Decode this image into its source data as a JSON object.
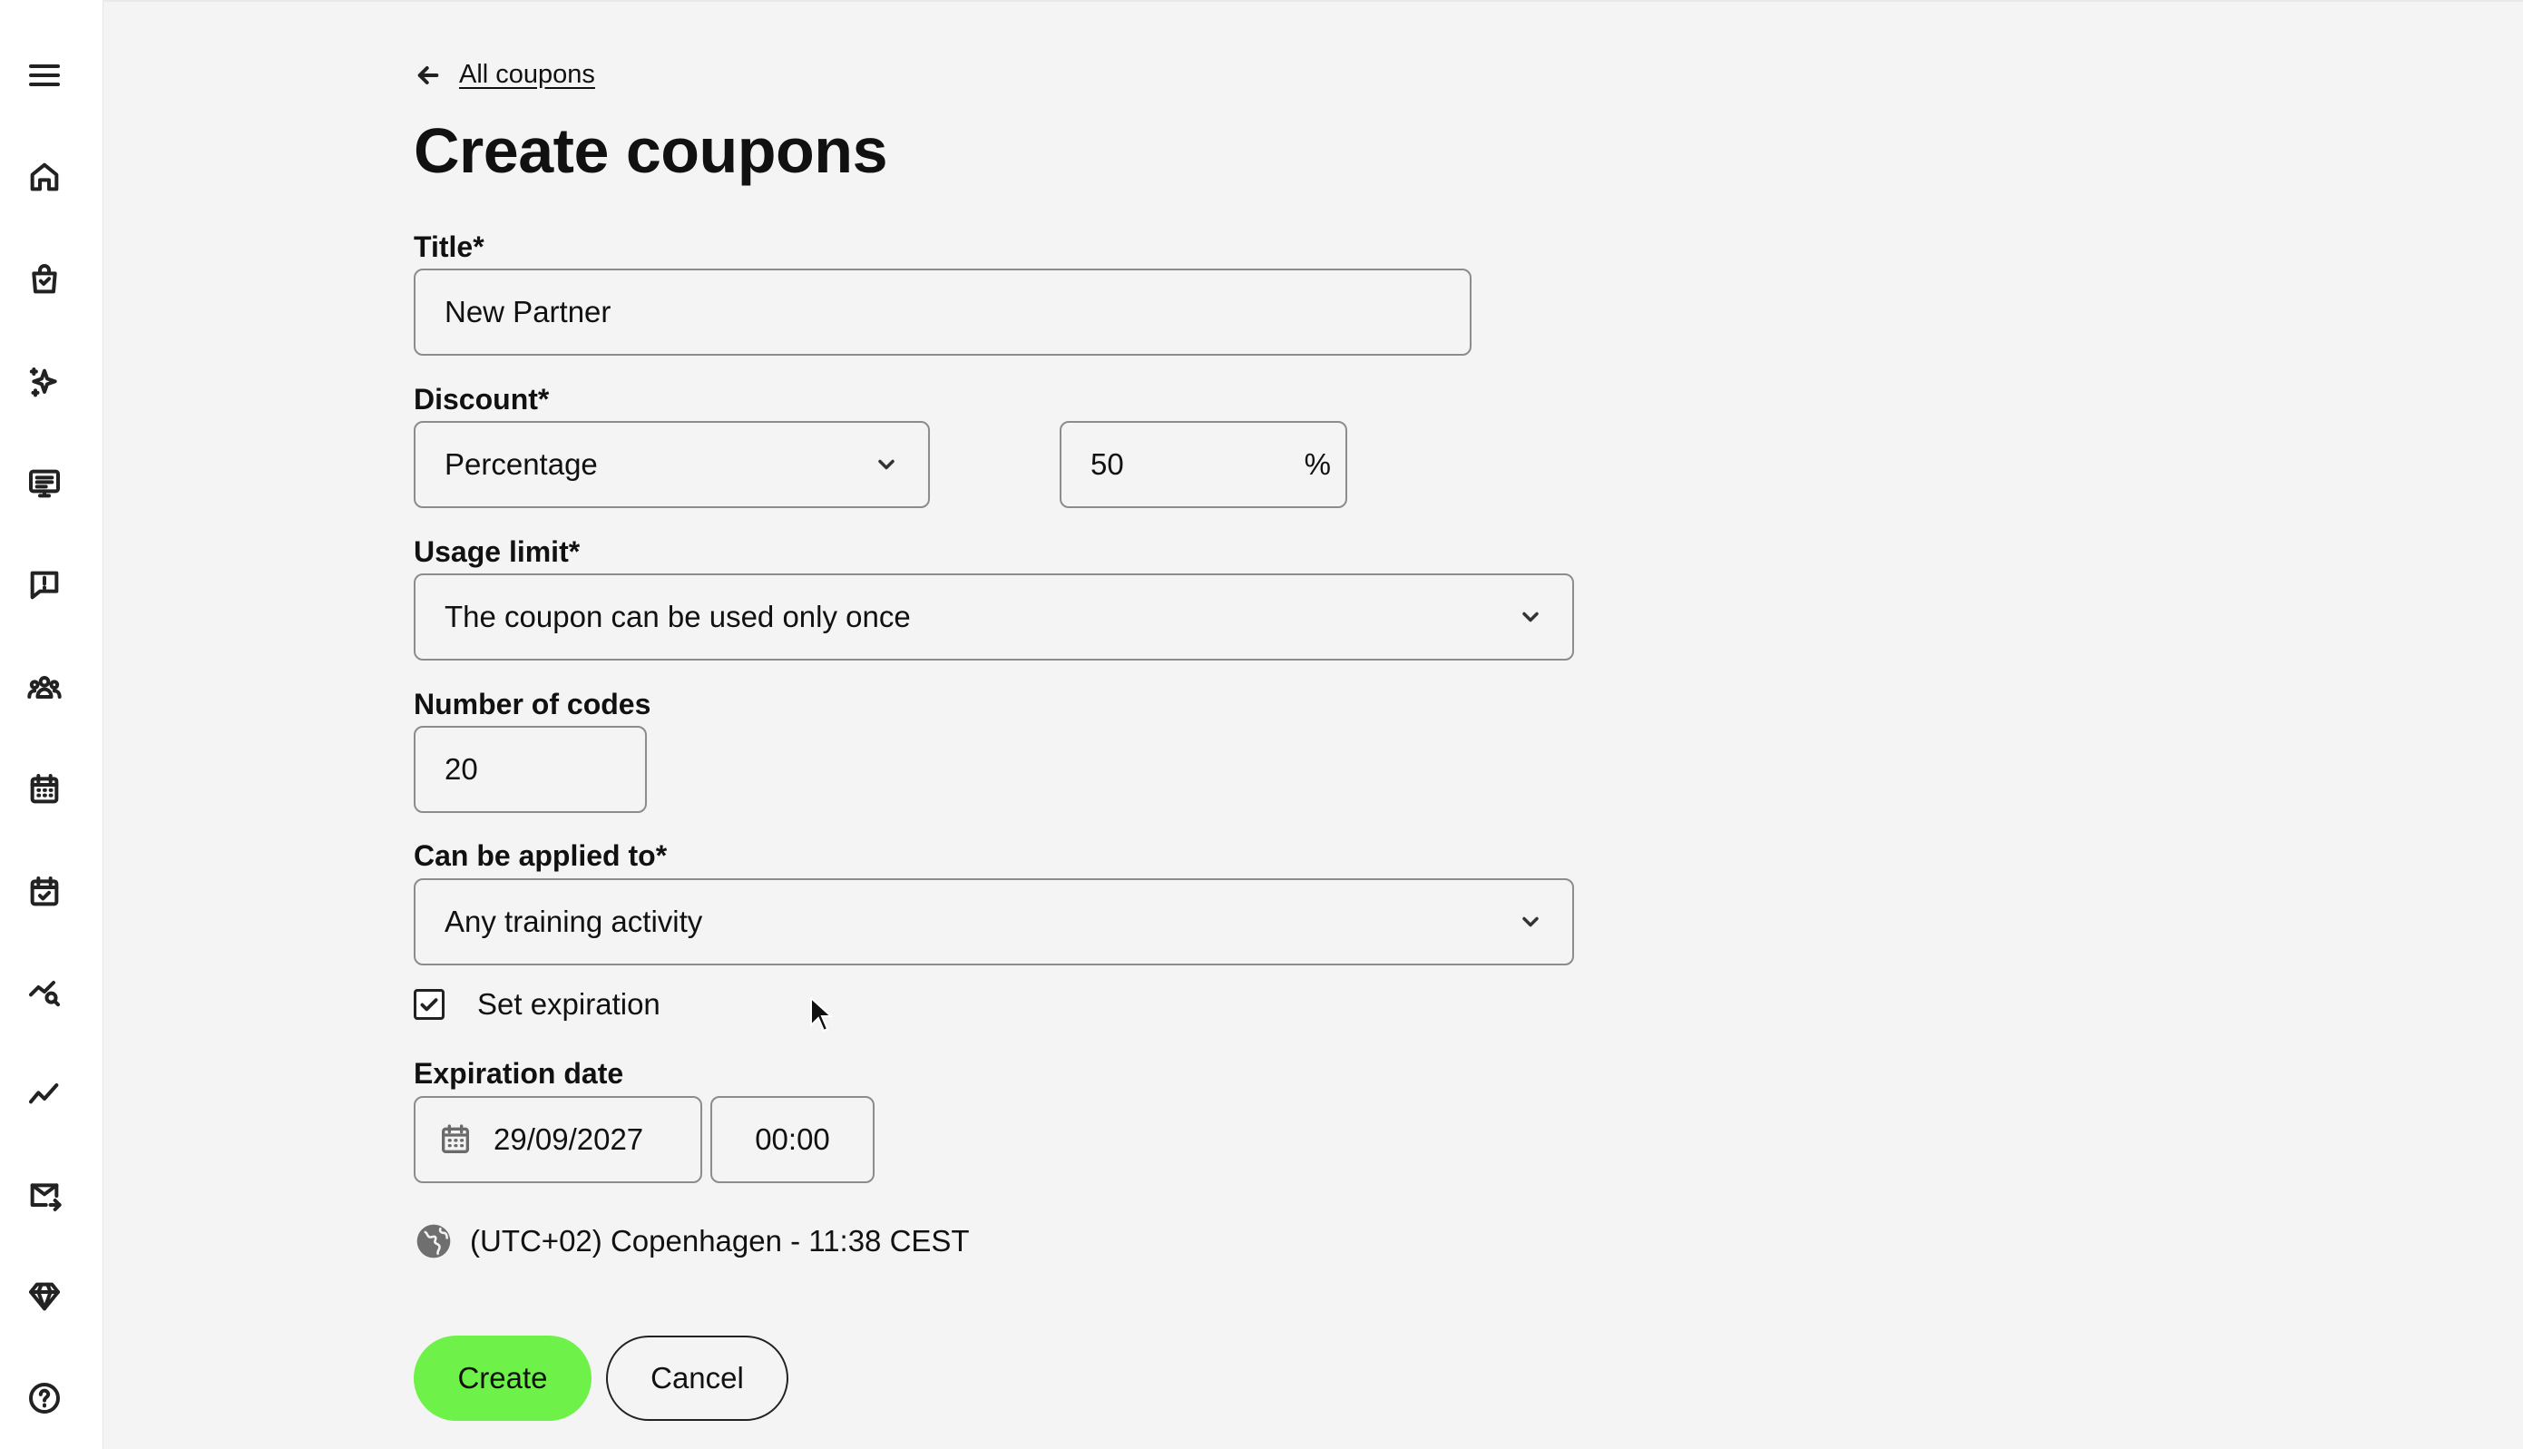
{
  "sidebar": {
    "icons": [
      {
        "name": "menu-icon"
      },
      {
        "name": "home-icon"
      },
      {
        "name": "shopping-bag-icon"
      },
      {
        "name": "sparkles-icon"
      },
      {
        "name": "display-list-icon"
      },
      {
        "name": "chat-alert-icon"
      },
      {
        "name": "users-group-icon"
      },
      {
        "name": "calendar-icon"
      },
      {
        "name": "calendar-check-icon"
      },
      {
        "name": "chart-search-icon"
      },
      {
        "name": "trend-line-icon"
      },
      {
        "name": "mail-forward-icon"
      },
      {
        "name": "diamond-icon"
      },
      {
        "name": "help-icon"
      }
    ]
  },
  "breadcrumb": {
    "back_label": "All coupons"
  },
  "page": {
    "title": "Create coupons"
  },
  "form": {
    "title": {
      "label": "Title*",
      "value": "New Partner"
    },
    "discount": {
      "label": "Discount*",
      "type_value": "Percentage",
      "amount_value": "50",
      "unit": "%"
    },
    "usage_limit": {
      "label": "Usage limit*",
      "value": "The coupon can be used only once"
    },
    "number_of_codes": {
      "label": "Number of codes",
      "value": "20"
    },
    "applied_to": {
      "label": "Can be applied to*",
      "value": "Any training activity"
    },
    "set_expiration": {
      "label": "Set expiration",
      "checked": true
    },
    "expiration_date": {
      "label": "Expiration date",
      "date": "29/09/2027",
      "time": "00:00"
    },
    "timezone": "(UTC+02) Copenhagen - 11:38 CEST"
  },
  "actions": {
    "create_label": "Create",
    "cancel_label": "Cancel"
  },
  "colors": {
    "accent": "#6ef24a",
    "background": "#f4f4f4",
    "border": "#8c8c8c"
  }
}
